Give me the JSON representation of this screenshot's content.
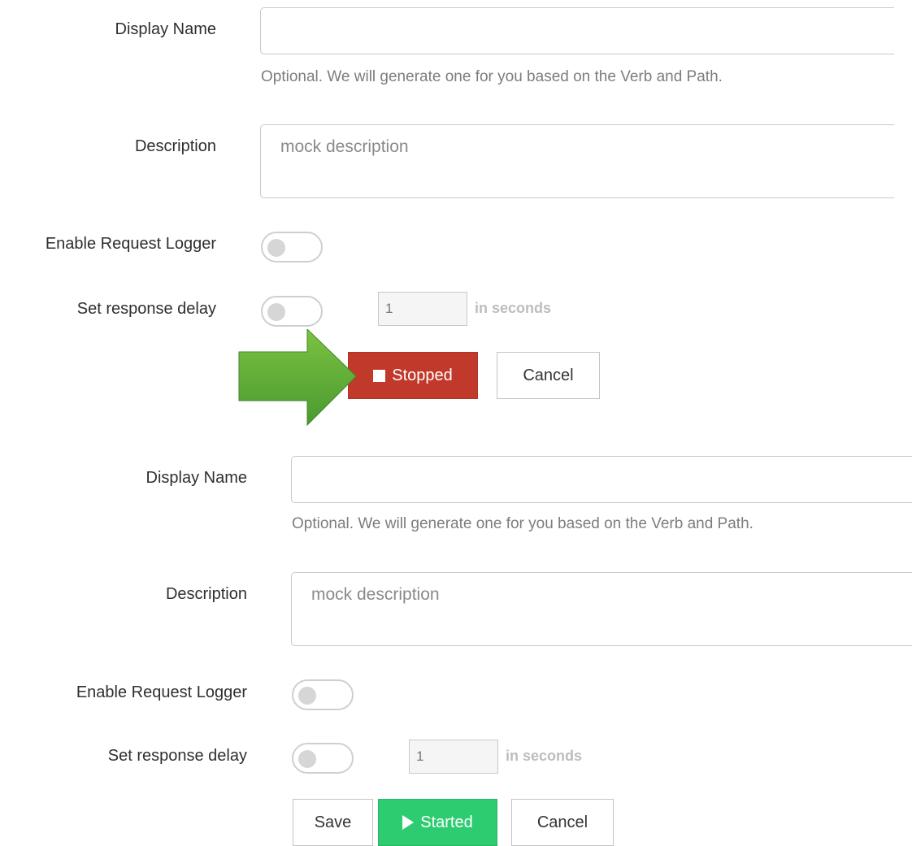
{
  "form_top": {
    "display_name": {
      "label": "Display Name",
      "value": "",
      "help": "Optional. We will generate one for you based on the Verb and Path."
    },
    "description": {
      "label": "Description",
      "placeholder": "mock description"
    },
    "request_logger": {
      "label": "Enable Request Logger",
      "enabled": false
    },
    "response_delay": {
      "label": "Set response delay",
      "enabled": false,
      "value": "1",
      "unit": "in seconds"
    },
    "buttons": {
      "status_label": "Stopped",
      "cancel_label": "Cancel"
    }
  },
  "form_bottom": {
    "display_name": {
      "label": "Display Name",
      "value": "",
      "help": "Optional. We will generate one for you based on the Verb and Path."
    },
    "description": {
      "label": "Description",
      "placeholder": "mock description"
    },
    "request_logger": {
      "label": "Enable Request Logger",
      "enabled": false
    },
    "response_delay": {
      "label": "Set response delay",
      "enabled": false,
      "value": "1",
      "unit": "in seconds"
    },
    "buttons": {
      "save_label": "Save",
      "status_label": "Started",
      "cancel_label": "Cancel"
    }
  },
  "colors": {
    "stopped": "#c0392b",
    "started": "#2ecc71",
    "annotation_arrow": "#5aa63a"
  },
  "icons": {
    "stopped": "stop-square-icon",
    "started": "play-icon",
    "annotation": "right-arrow-annotation-icon"
  }
}
